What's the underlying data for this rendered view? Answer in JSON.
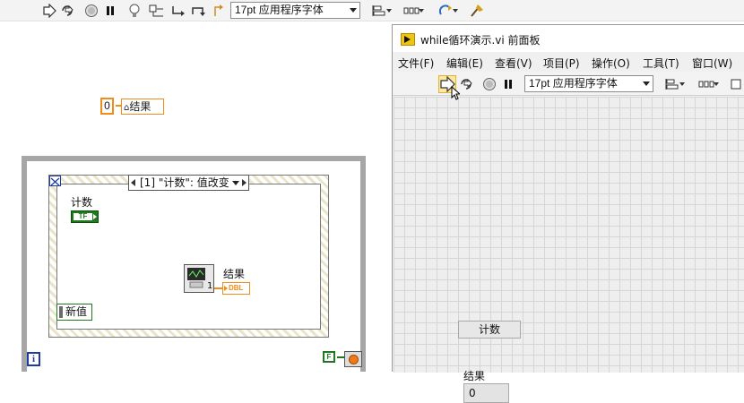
{
  "block_diagram": {
    "toolbar": {
      "font_select": "17pt 应用程序字体",
      "icons": [
        "run-arrow-icon",
        "highlight-execution-icon",
        "abort-icon",
        "pause-icon",
        "bulb-icon",
        "retain-wire-icon",
        "step-into-icon",
        "step-over-icon",
        "step-out-icon",
        "align-icon",
        "distribute-icon",
        "reorder-icon",
        "cleanup-icon"
      ]
    },
    "constant_zero": "0",
    "local_variable_label": "结果",
    "event_selector_label": "[1] \"计数\": 值改变",
    "count_terminal_label": "计数",
    "count_terminal_type": "TF",
    "new_value_label": "新值",
    "result_terminal_label": "结果",
    "result_terminal_type": "DBL",
    "constant_one": "1",
    "iteration_label": "i",
    "stop_terminal_label": "F"
  },
  "front_panel": {
    "title": "while循环演示.vi 前面板",
    "menu": [
      "文件(F)",
      "编辑(E)",
      "查看(V)",
      "项目(P)",
      "操作(O)",
      "工具(T)",
      "窗口(W)"
    ],
    "font_select": "17pt 应用程序字体",
    "count_button_label": "计数",
    "result_label": "结果",
    "result_value": "0"
  },
  "colors": {
    "numeric_orange": "#f08c1c",
    "boolean_green": "#1f7a1f",
    "loop_gray": "#a6a6a6",
    "iteration_blue": "#1e3aa6"
  }
}
